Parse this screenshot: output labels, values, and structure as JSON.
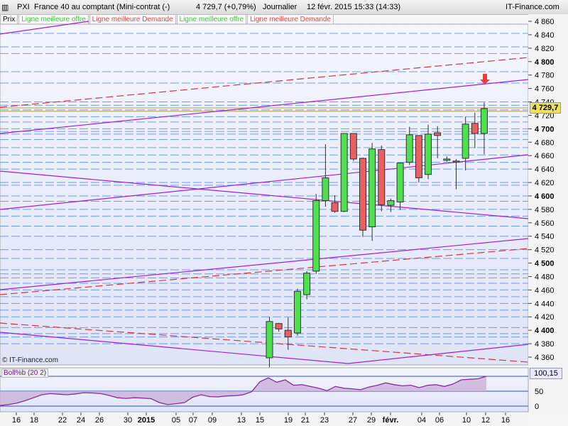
{
  "header": {
    "symbol": "PXI",
    "instrument": "France 40 au comptant (Mini-contrat  (-)",
    "quote": "4 729,7 (+0,79%)",
    "period": "Journalier",
    "datetime": "12 févr. 2015 15:33 (14:33)",
    "source": "IT-Finance.com"
  },
  "legend": {
    "prix": "Prix",
    "items": [
      {
        "label": "Ligne meilleure offre",
        "color": "#39c83c"
      },
      {
        "label": "Ligne meilleure Demande",
        "color": "#e04848"
      },
      {
        "label": "Ligne meilleure offre",
        "color": "#39c83c"
      },
      {
        "label": "Ligne meilleure Demande",
        "color": "#e04848"
      }
    ]
  },
  "watermark": "© IT-Finance.com",
  "last_price_label": "4 729,7",
  "colors": {
    "up": "#4fe04f",
    "down": "#e86060",
    "support": "#5b8de8",
    "trendline": "#a020d0",
    "channel_dash": "#dd3333",
    "indicator_fill": "#c9b0d8"
  },
  "chart_data": {
    "type": "candlestick",
    "ylim": [
      4350,
      4870
    ],
    "y_ticks": [
      "4 860",
      "4 840",
      "4 820",
      "4 800",
      "4 780",
      "4 760",
      "4 740",
      "4 720",
      "4 700",
      "4 680",
      "4 660",
      "4 640",
      "4 620",
      "4 600",
      "4 580",
      "4 560",
      "4 540",
      "4 520",
      "4 500",
      "4 480",
      "4 460",
      "4 440",
      "4 420",
      "4 400",
      "4 380",
      "4 360"
    ],
    "x_tick_labels": [
      "16",
      "18",
      "22",
      "24",
      "26",
      "30",
      "2015",
      "05",
      "07",
      "09",
      "13",
      "15",
      "19",
      "21",
      "23",
      "27",
      "29",
      "févr.",
      "04",
      "06",
      "10",
      "12",
      "16"
    ],
    "candles": [
      {
        "o": 4359,
        "h": 4420,
        "l": 4345,
        "c": 4413
      },
      {
        "o": 4410,
        "h": 4411,
        "l": 4398,
        "c": 4402
      },
      {
        "o": 4400,
        "h": 4419,
        "l": 4371,
        "c": 4390
      },
      {
        "o": 4396,
        "h": 4462,
        "l": 4392,
        "c": 4458
      },
      {
        "o": 4453,
        "h": 4488,
        "l": 4446,
        "c": 4485
      },
      {
        "o": 4488,
        "h": 4603,
        "l": 4484,
        "c": 4593
      },
      {
        "o": 4593,
        "h": 4677,
        "l": 4584,
        "c": 4627
      },
      {
        "o": 4590,
        "h": 4601,
        "l": 4575,
        "c": 4577
      },
      {
        "o": 4577,
        "h": 4693,
        "l": 4576,
        "c": 4693
      },
      {
        "o": 4693,
        "h": 4693,
        "l": 4652,
        "c": 4655
      },
      {
        "o": 4656,
        "h": 4657,
        "l": 4539,
        "c": 4549
      },
      {
        "o": 4554,
        "h": 4679,
        "l": 4533,
        "c": 4670
      },
      {
        "o": 4669,
        "h": 4675,
        "l": 4577,
        "c": 4587
      },
      {
        "o": 4586,
        "h": 4596,
        "l": 4576,
        "c": 4593
      },
      {
        "o": 4591,
        "h": 4648,
        "l": 4579,
        "c": 4649
      },
      {
        "o": 4650,
        "h": 4703,
        "l": 4646,
        "c": 4691
      },
      {
        "o": 4690,
        "h": 4690,
        "l": 4620,
        "c": 4627
      },
      {
        "o": 4632,
        "h": 4706,
        "l": 4625,
        "c": 4692
      },
      {
        "o": 4694,
        "h": 4704,
        "l": 4656,
        "c": 4690
      },
      {
        "o": 4653,
        "h": 4659,
        "l": 4651,
        "c": 4655
      },
      {
        "o": 4651,
        "h": 4655,
        "l": 4610,
        "c": 4652
      },
      {
        "o": 4656,
        "h": 4718,
        "l": 4638,
        "c": 4707
      },
      {
        "o": 4708,
        "h": 4724,
        "l": 4671,
        "c": 4693
      },
      {
        "o": 4693,
        "h": 4739,
        "l": 4662,
        "c": 4730
      }
    ],
    "indicator": {
      "name": "Boll%b (20 2)",
      "last_value": "100,15",
      "y_ticks": [
        "50",
        "0"
      ],
      "values": [
        2,
        5,
        10,
        18,
        28,
        38,
        42,
        40,
        38,
        41,
        45,
        44,
        42,
        36,
        28,
        26,
        28,
        27,
        25,
        12,
        5,
        8,
        12,
        30,
        38,
        32,
        31,
        34,
        35,
        38,
        48,
        82,
        95,
        80,
        88,
        70,
        72,
        66,
        60,
        52,
        66,
        60,
        58,
        55,
        64,
        70,
        78,
        72,
        68,
        70,
        62,
        70,
        72,
        66,
        74,
        88,
        90,
        92,
        100
      ]
    }
  }
}
